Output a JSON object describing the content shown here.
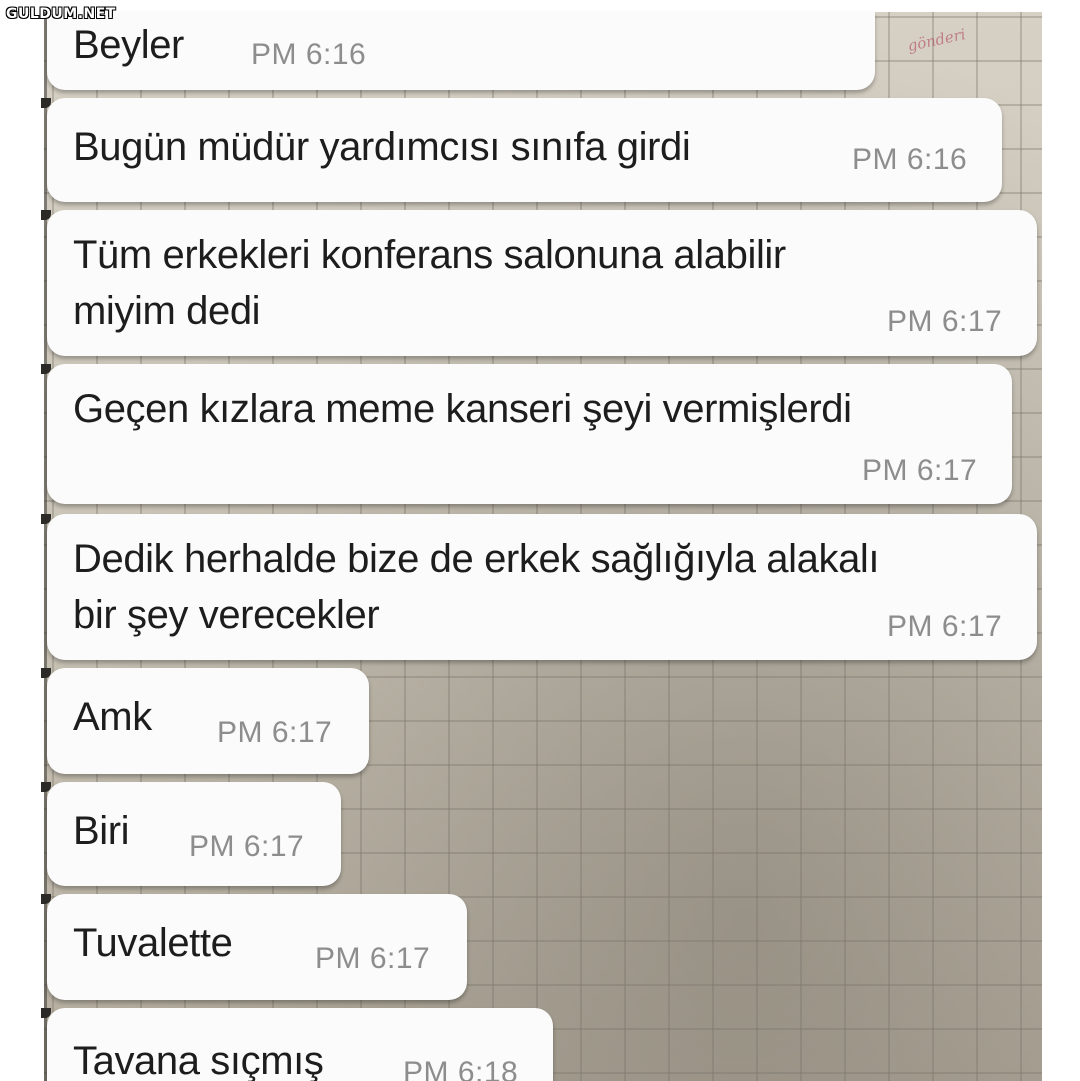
{
  "watermark": "GULDUM.NET",
  "background_scribble": "gönderi",
  "messages": [
    {
      "text": "Beyler",
      "time": "PM 6:16"
    },
    {
      "text": "Bugün müdür yardımcısı sınıfa girdi",
      "time": "PM 6:16"
    },
    {
      "lines": [
        "Tüm erkekleri konferans salonuna alabilir",
        "miyim dedi"
      ],
      "time": "PM 6:17"
    },
    {
      "text": "Geçen kızlara meme kanseri şeyi vermişlerdi",
      "time": "PM 6:17"
    },
    {
      "lines": [
        "Dedik herhalde bize de erkek sağlığıyla alakalı",
        "bir şey verecekler"
      ],
      "time": "PM 6:17"
    },
    {
      "text": "Amk",
      "time": "PM 6:17"
    },
    {
      "text": "Biri",
      "time": "PM 6:17"
    },
    {
      "text": "Tuvalette",
      "time": "PM 6:17"
    },
    {
      "text": "Tavana sıçmış",
      "time": "PM 6:18"
    }
  ],
  "colors": {
    "bubble": "#fbfbfb",
    "message_text": "#1d1d1d",
    "timestamp": "#8d8d8d",
    "backdrop": "#cdc8bd"
  }
}
